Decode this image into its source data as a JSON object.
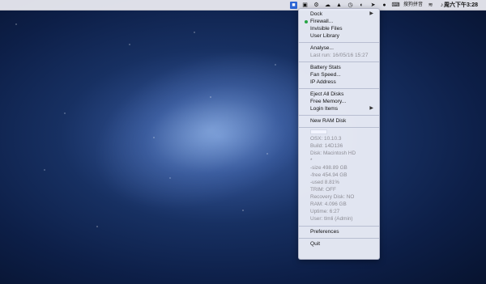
{
  "menubar": {
    "clock": "周六下午3:28",
    "status_text": "搜狗拼音",
    "icons": [
      {
        "name": "app-icon-active"
      },
      {
        "name": "display-icon"
      },
      {
        "name": "bike-icon"
      },
      {
        "name": "cloud-icon"
      },
      {
        "name": "hat-icon"
      },
      {
        "name": "clock-icon"
      },
      {
        "name": "moon-icon"
      },
      {
        "name": "send-icon"
      },
      {
        "name": "person-icon"
      },
      {
        "name": "keyboard-icon"
      },
      {
        "name": "wifi-icon"
      },
      {
        "name": "volume-icon"
      }
    ]
  },
  "menu": {
    "dock": "Dock",
    "firewall": "Firewall...",
    "invisible": "Invisible Files",
    "user_library": "User Library",
    "analyse": "Analyse...",
    "last_run": "Last run: 16/05/16 15:27",
    "battery": "Battery Stats",
    "fan": "Fan Speed...",
    "ip": "IP Address",
    "eject": "Eject All Disks",
    "free_memory": "Free Memory...",
    "login_items": "Login Items",
    "new_ram": "New RAM Disk",
    "osx": "OSX:     10.10.3",
    "build": "Build:     14D136",
    "disk": "Disk:     Macintosh HD",
    "star": "*",
    "size": "  -size   498.89 GB",
    "free": "  -free   454.94 GB",
    "used": "  -used  8.81%",
    "trim": "   TRIM:   OFF",
    "recovery": "Recovery Disk: NO",
    "ram": "RAM:     4.096 GB",
    "uptime": "Uptime:   6:27",
    "user": "User:     tlmli  (Admin)",
    "preferences": "Preferences",
    "quit": "Quit"
  }
}
